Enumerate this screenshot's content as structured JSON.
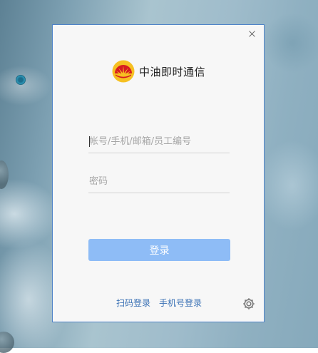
{
  "app": {
    "title": "中油即时通信"
  },
  "form": {
    "account_placeholder": "帐号/手机/邮箱/员工编号",
    "account_value": "",
    "password_placeholder": "密码",
    "password_value": "",
    "login_label": "登录"
  },
  "links": {
    "qr_login": "扫码登录",
    "phone_login": "手机号登录"
  },
  "icons": {
    "close": "close-icon",
    "settings": "gear-icon",
    "logo": "petrochina-logo"
  },
  "colors": {
    "accent": "#8ebcf6",
    "link": "#3a71b5",
    "border": "#4f83c8",
    "logo_red": "#d71a21",
    "logo_yellow": "#f6c022"
  }
}
